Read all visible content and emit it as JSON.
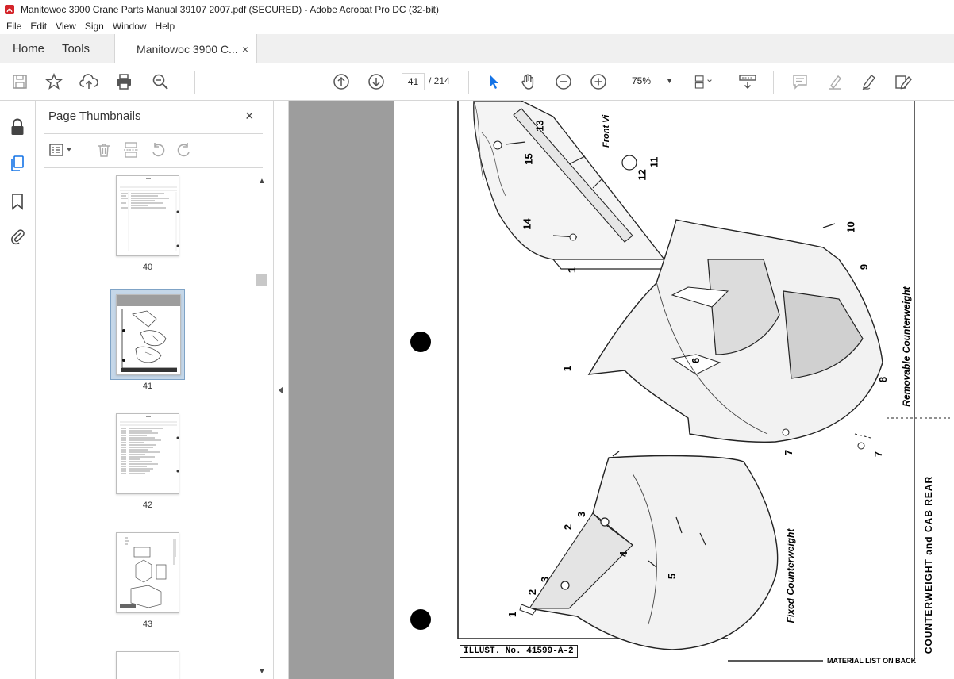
{
  "window": {
    "title": "Manitowoc 3900 Crane Parts Manual 39107 2007.pdf (SECURED) - Adobe Acrobat Pro DC (32-bit)"
  },
  "menu": [
    "File",
    "Edit",
    "View",
    "Sign",
    "Window",
    "Help"
  ],
  "tabs": {
    "home": "Home",
    "tools": "Tools",
    "document": "Manitowoc 3900 C...",
    "close": "×"
  },
  "toolbar": {
    "current_page": "41",
    "total_pages": "/ 214",
    "zoom": "75%"
  },
  "panel": {
    "title": "Page Thumbnails",
    "close": "×",
    "thumbnails": [
      {
        "label": "40"
      },
      {
        "label": "41",
        "selected": true
      },
      {
        "label": "42"
      },
      {
        "label": "43"
      }
    ]
  },
  "document_page": {
    "callouts": [
      "1",
      "2",
      "3",
      "2",
      "3",
      "4",
      "5",
      "1",
      "6",
      "7",
      "7",
      "8",
      "9",
      "10",
      "1",
      "11",
      "12",
      "13",
      "14",
      "15"
    ],
    "front_view_label": "Front Vi",
    "removable_label": "Removable Counterweight",
    "fixed_label": "Fixed Counterweight",
    "section_title": "COUNTERWEIGHT and CAB REAR",
    "illustration_number": "ILLUST. No. 41599-A-2",
    "material_note": "MATERIAL LIST ON BACK"
  },
  "colors": {
    "accent_blue": "#1473e6",
    "panel_select": "#c5d7e8",
    "viewer_bg": "#9d9d9d",
    "app_red": "#d4252a"
  },
  "icons": [
    "pdf-app-icon",
    "save-icon",
    "star-icon",
    "upload-icon",
    "print-icon",
    "zoom-search-icon",
    "page-up-icon",
    "page-down-icon",
    "select-cursor-icon",
    "hand-icon",
    "zoom-out-icon",
    "zoom-in-icon",
    "page-fit-icon",
    "scroll-mode-icon",
    "comment-icon",
    "highlight-icon",
    "sign-icon",
    "edit-icon",
    "lock-icon",
    "pages-icon",
    "bookmark-icon",
    "attachment-icon",
    "options-icon",
    "delete-icon",
    "insert-icon",
    "undo-icon",
    "redo-icon",
    "collapse-arrow-icon"
  ]
}
